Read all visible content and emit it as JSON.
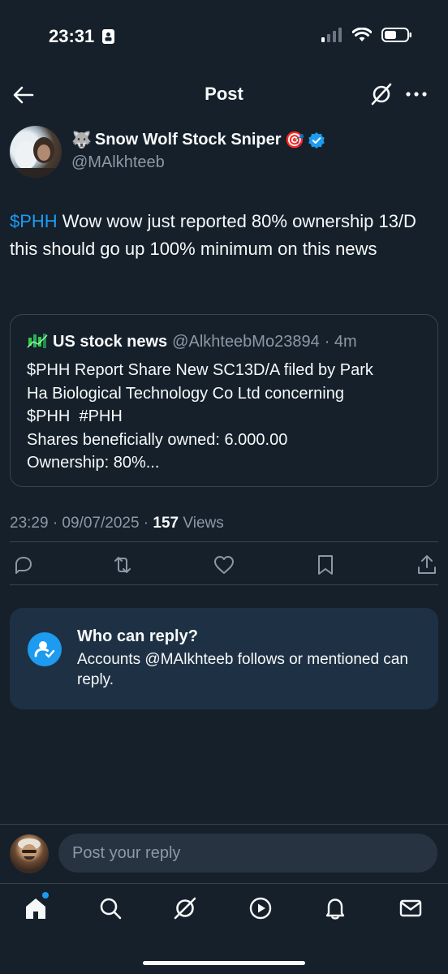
{
  "status_bar": {
    "time": "23:31"
  },
  "header": {
    "title": "Post"
  },
  "author": {
    "name": "Snow Wolf Stock Sniper",
    "emoji_prefix": "🐺",
    "emoji_suffix": "🎯",
    "handle": "@MAlkhteeb",
    "verified": true
  },
  "tweet": {
    "cashtag": "$PHH",
    "text": " Wow wow just reported 80% ownership 13/D this should go up 100% minimum on this news"
  },
  "quote": {
    "name": "US stock news",
    "handle": "@AlkhteebMo23894",
    "time": "· 4m",
    "lines": [
      "$PHH Report Share New SC13D/A filed by Park",
      "Ha Biological Technology Co Ltd concerning",
      "$PHH  #PHH",
      "Shares beneficially owned: 6.000.00",
      "Ownership: 80%..."
    ]
  },
  "meta": {
    "timestamp": "23:29 · 09/07/2025 · ",
    "views_count": "157",
    "views_label": " Views"
  },
  "who_can_reply": {
    "title": "Who can reply?",
    "description": "Accounts @MAlkhteeb follows or mentioned can reply."
  },
  "composer": {
    "placeholder": "Post your reply"
  },
  "colors": {
    "background": "#15202b",
    "accent": "#1d9bf0",
    "muted": "#8b98a5",
    "card": "#1e3144"
  },
  "icons": [
    "back-arrow-icon",
    "grok-icon",
    "more-icon",
    "reply-icon",
    "repost-icon",
    "like-icon",
    "bookmark-icon",
    "share-icon",
    "home-icon",
    "search-icon",
    "grok-icon",
    "video-icon",
    "notifications-icon",
    "messages-icon"
  ]
}
